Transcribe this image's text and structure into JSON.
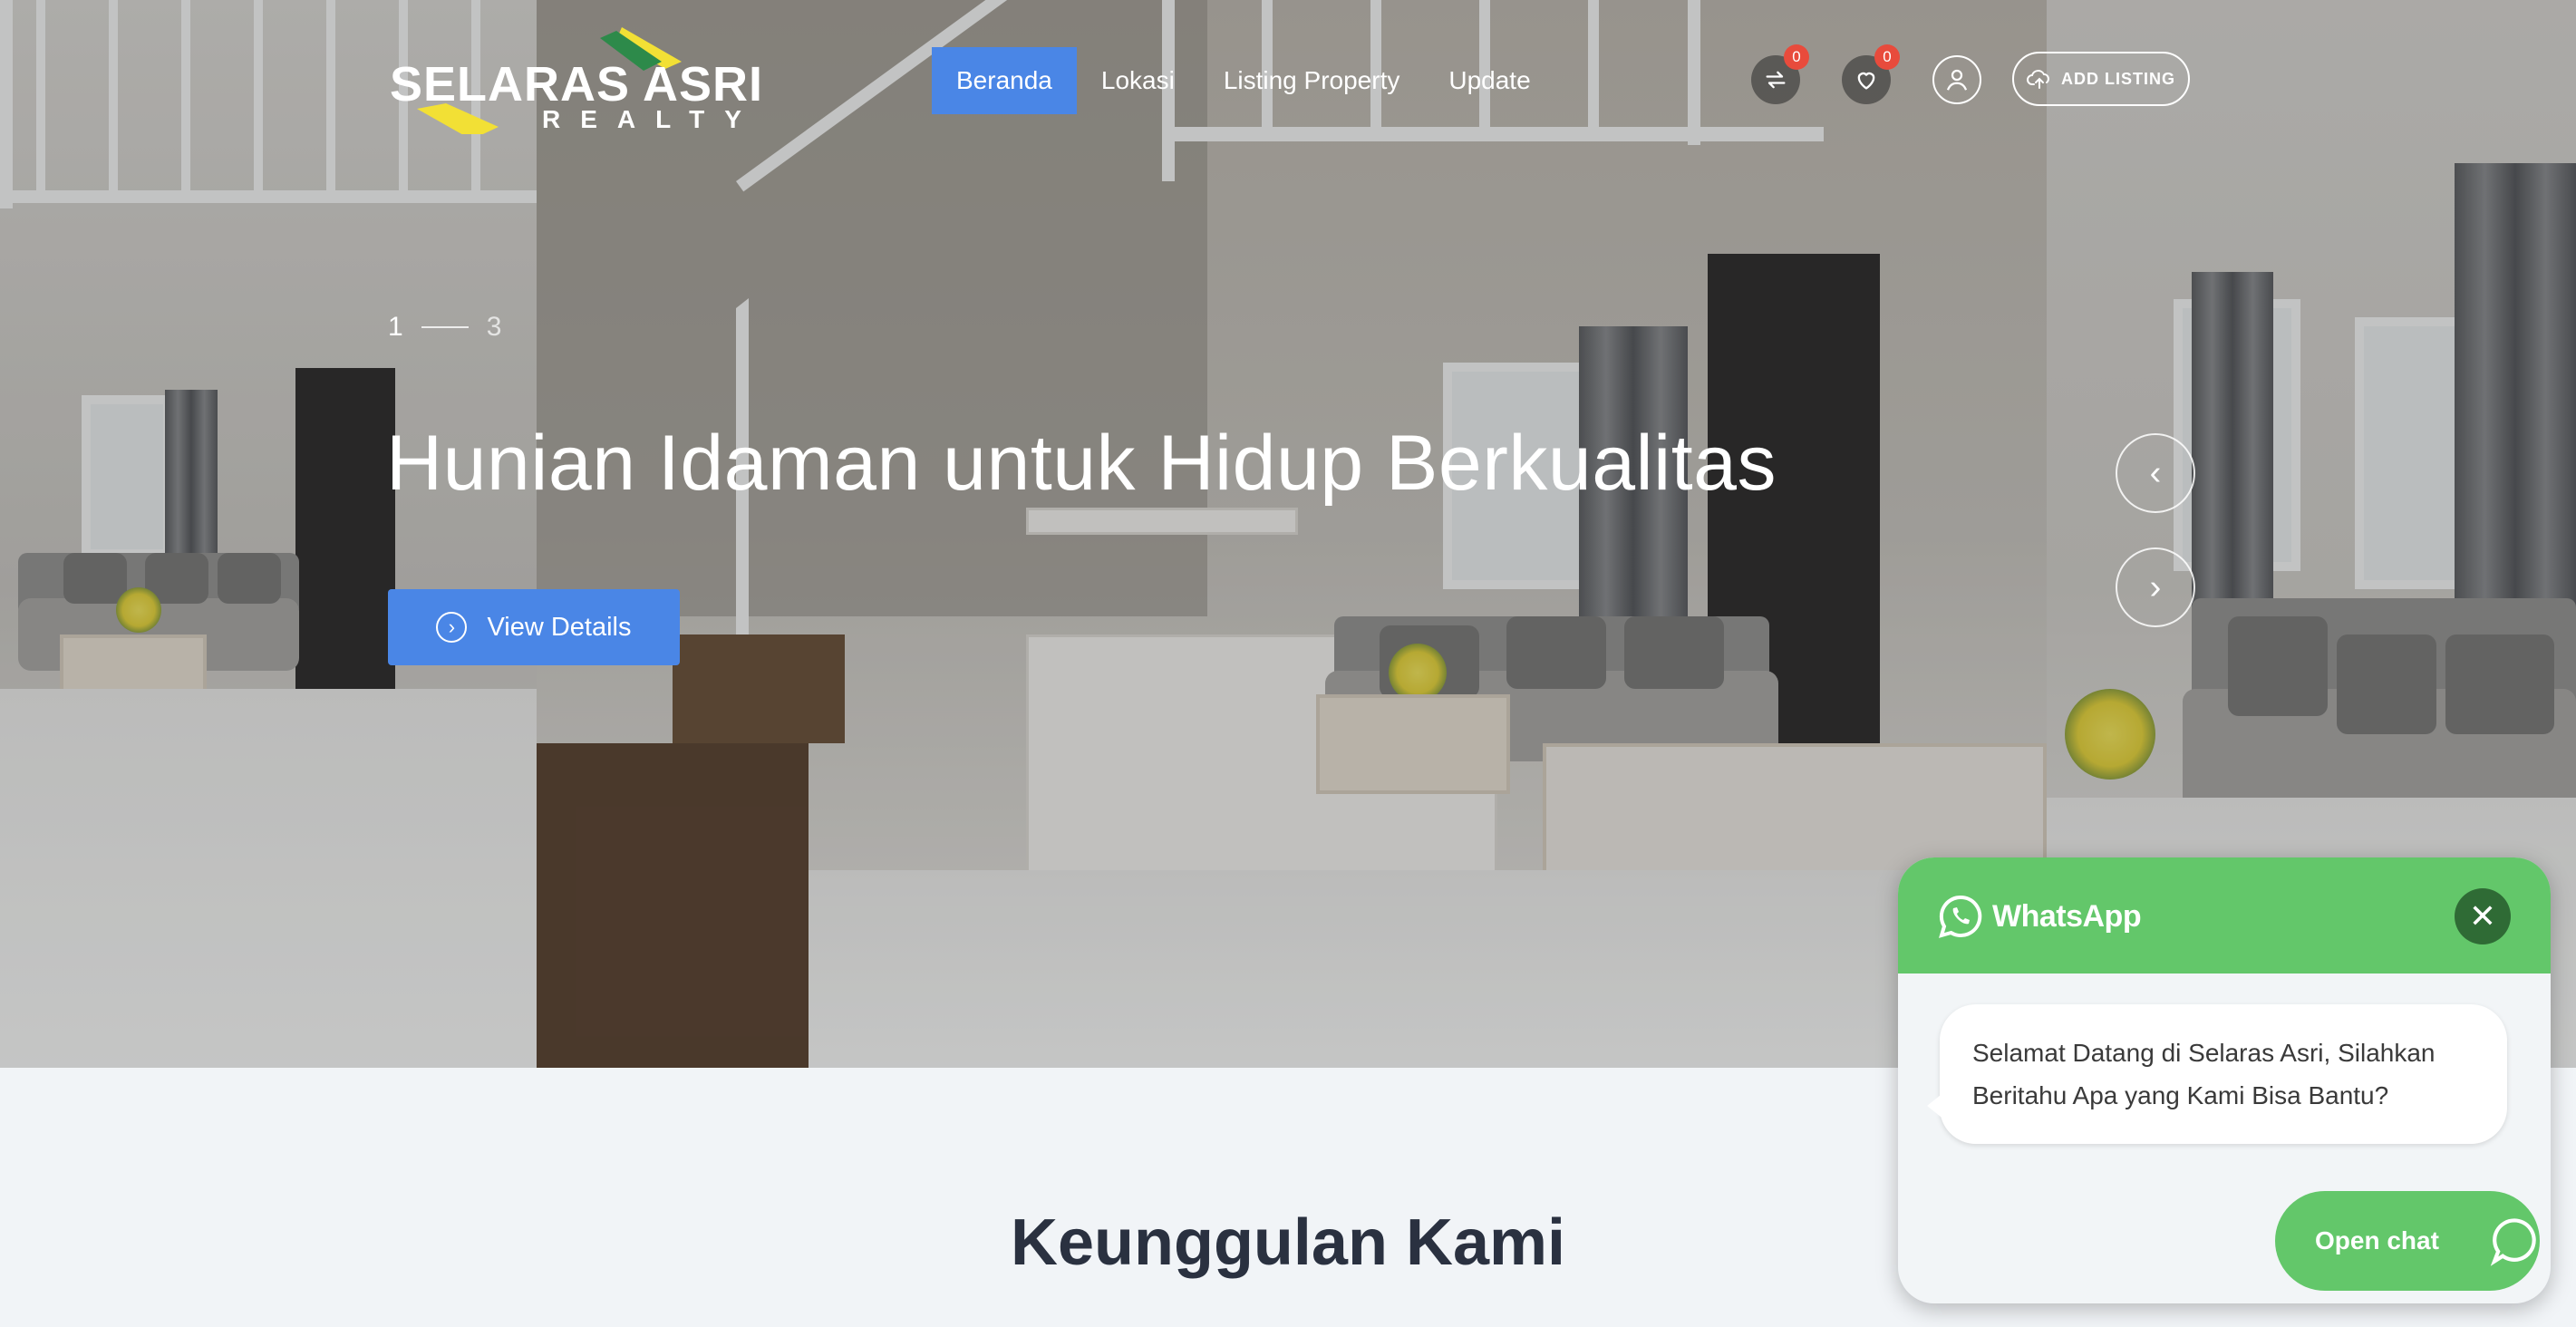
{
  "brand": {
    "name": "SELARAS ASRI",
    "tagline": "REALTY",
    "colors": {
      "accent": "#4a86e6",
      "badge": "#e84b3c",
      "whatsapp": "#63c76a",
      "whatsapp_dark": "#2f6b35",
      "logo_yellow": "#f2e035",
      "logo_green": "#2d8a4a"
    }
  },
  "nav": {
    "items": [
      {
        "label": "Beranda",
        "active": true
      },
      {
        "label": "Lokasi",
        "active": false
      },
      {
        "label": "Listing Property",
        "active": false
      },
      {
        "label": "Update",
        "active": false
      }
    ]
  },
  "header_actions": {
    "compare": {
      "icon": "compare-arrows-icon",
      "count": "0"
    },
    "favorites": {
      "icon": "heart-icon",
      "count": "0"
    },
    "account": {
      "icon": "user-icon"
    },
    "add_listing": {
      "icon": "cloud-upload-icon",
      "label": "ADD LISTING"
    }
  },
  "hero": {
    "slide_current": "1",
    "slide_total": "3",
    "title": "Hunian Idaman untuk Hidup Berkualitas",
    "cta_label": "View Details",
    "cta_icon": "circle-chevron-right-icon",
    "prev_icon": "chevron-left-icon",
    "next_icon": "chevron-right-icon"
  },
  "section": {
    "title": "Keunggulan Kami"
  },
  "whatsapp": {
    "brand": "WhatsApp",
    "message": "Selamat Datang di Selaras Asri, Silahkan Beritahu Apa yang Kami Bisa Bantu?",
    "open_label": "Open chat",
    "close_icon": "close-icon",
    "chat_icon": "chat-bubble-icon"
  }
}
